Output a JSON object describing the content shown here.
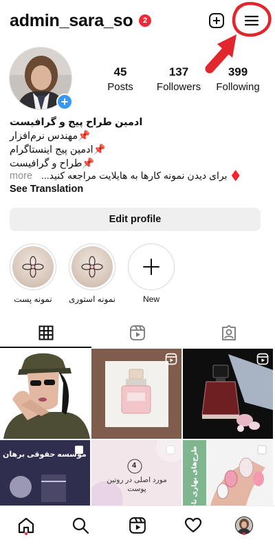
{
  "header": {
    "username": "admin_sara_so",
    "notification_count": "2"
  },
  "profile": {
    "stats": [
      {
        "value": "45",
        "label": "Posts"
      },
      {
        "value": "137",
        "label": "Followers"
      },
      {
        "value": "399",
        "label": "Following"
      }
    ]
  },
  "bio": {
    "name": "ادمین طراح پیج و گرافیست",
    "lines": [
      "📌مهندس نرم‌افزار",
      "📌ادمین پیج اینستاگرام",
      "📌طراح و گرافیست"
    ],
    "more": "more",
    "last_line": "♦️ برای دیدن نمونه کارها به هایلایت مراجعه کنید...",
    "see_translation": "See Translation"
  },
  "actions": {
    "edit_profile": "Edit profile"
  },
  "highlights": [
    {
      "label": "نمونه پست"
    },
    {
      "label": "نمونه استوری"
    },
    {
      "label": "New"
    }
  ],
  "grid": {
    "post_texts": {
      "law_post": "موسسه حقوقی برهان",
      "routine_num": "4",
      "routine_text": "مورد اصلی در روتین پوست",
      "nail_text": "طرح‌های بهاری ناخن"
    }
  },
  "colors": {
    "accent_blue": "#3897f0",
    "badge_red": "#ee2a3a",
    "annotation_red": "#e1262d"
  },
  "icons": {
    "add": "plus-square-icon",
    "menu": "hamburger-menu-icon",
    "grid_tab": "grid-icon",
    "reels_tab": "reels-icon",
    "tagged_tab": "tagged-icon",
    "home": "home-icon",
    "search": "search-icon",
    "reels": "reels-icon",
    "activity": "heart-icon",
    "profile": "avatar-icon"
  }
}
